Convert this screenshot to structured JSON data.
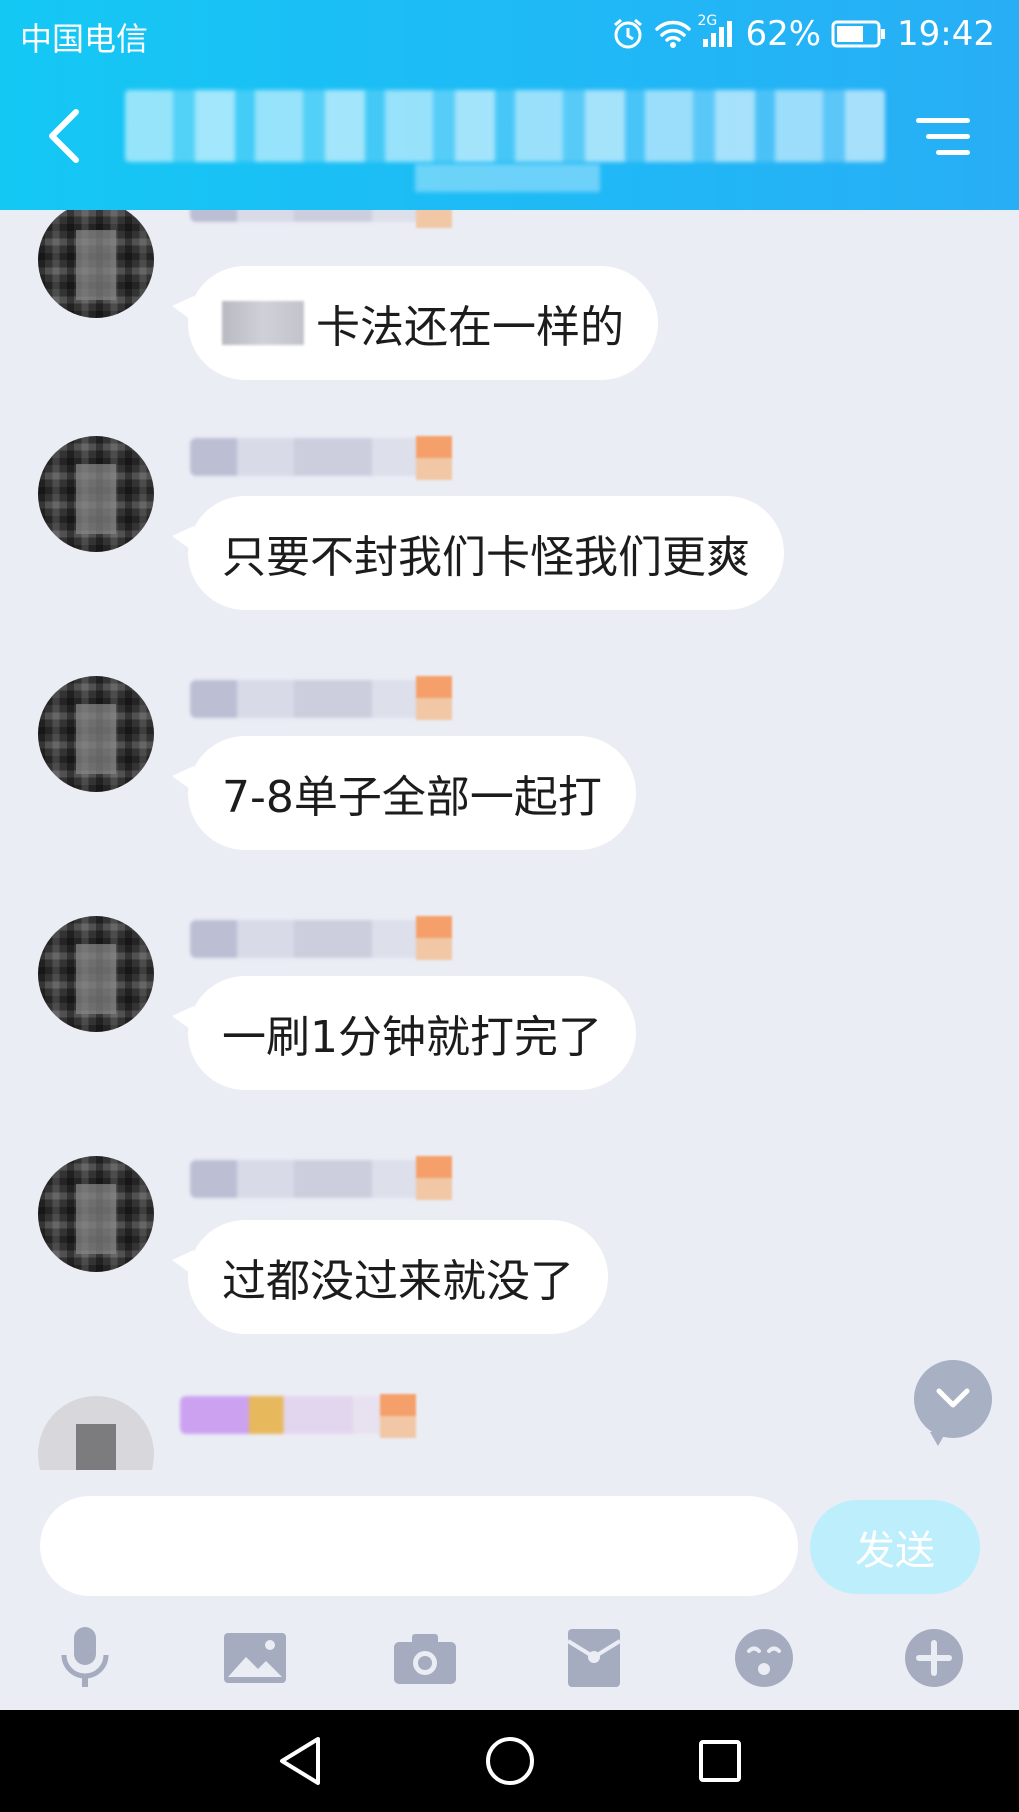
{
  "status_bar": {
    "carrier": "中国电信",
    "network": "2G",
    "battery": "62%",
    "time": "19:42"
  },
  "header": {
    "back_icon": "chevron-left-icon",
    "menu_icon": "menu-icon",
    "title_redacted": true
  },
  "messages": [
    {
      "text": "卡法还在一样的",
      "prefix_redacted": true
    },
    {
      "text": "只要不封我们卡怪我们更爽"
    },
    {
      "text": "7-8单子全部一起打"
    },
    {
      "text": "一刷1分钟就打完了"
    },
    {
      "text": "过都没过来就没了"
    }
  ],
  "input": {
    "value": "",
    "placeholder": "",
    "send_label": "发送"
  },
  "toolbar_icons": [
    "microphone-icon",
    "image-icon",
    "camera-icon",
    "red-packet-icon",
    "emoji-icon",
    "plus-icon"
  ],
  "colors": {
    "header_start": "#14c8f4",
    "header_end": "#28aef5",
    "chat_bg": "#ebedf5",
    "send_button": "#bdeefc",
    "icon_gray": "#a6acc0"
  }
}
